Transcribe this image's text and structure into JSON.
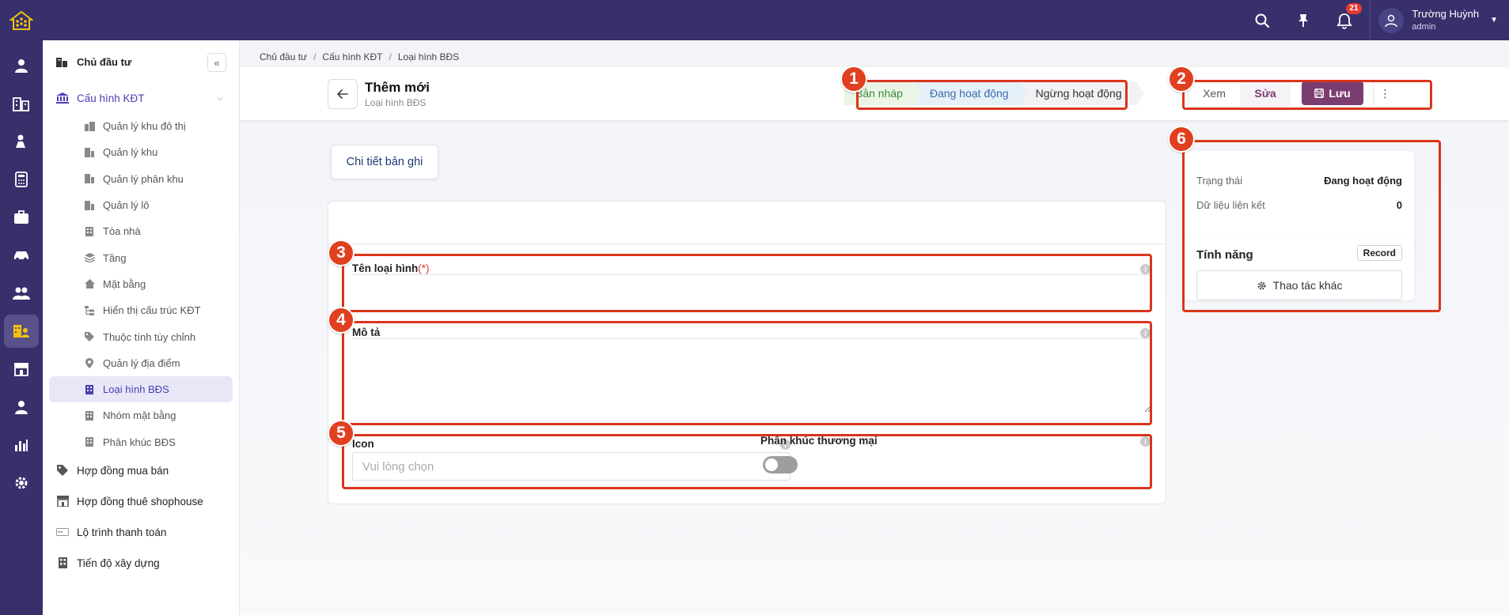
{
  "topbar": {
    "notification_count": "21",
    "user_name": "Trường Huỳnh",
    "user_role": "admin"
  },
  "sidebar": {
    "header": "Chủ đầu tư",
    "group": "Cấu hình KĐT",
    "sub_items": [
      "Quản lý khu đô thị",
      "Quản lý khu",
      "Quản lý phân khu",
      "Quản lý lô",
      "Tòa nhà",
      "Tầng",
      "Mặt bằng",
      "Hiển thị cấu trúc KĐT",
      "Thuộc tính tùy chỉnh",
      "Quản lý địa điểm",
      "Loại hình BĐS",
      "Nhóm mặt bằng",
      "Phân khúc BĐS"
    ],
    "main_items": [
      "Hợp đồng mua bán",
      "Hợp đồng thuê shophouse",
      "Lộ trình thanh toán",
      "Tiến độ xây dựng"
    ]
  },
  "breadcrumb": [
    "Chủ đầu tư",
    "Cấu hình KĐT",
    "Loại hình BĐS"
  ],
  "header": {
    "title": "Thêm mới",
    "subtitle": "Loại hình BĐS"
  },
  "status_steps": [
    "Bản nháp",
    "Đang hoạt động",
    "Ngừng hoạt động"
  ],
  "actions": {
    "view": "Xem",
    "edit": "Sửa",
    "save": "Lưu",
    "more": "⋮"
  },
  "tab": "Chi tiết bản ghi",
  "form": {
    "name_label": "Tên loại hình",
    "required_mark": "(*)",
    "desc_label": "Mô tả",
    "icon_label": "Icon",
    "icon_placeholder": "Vui lòng chọn",
    "segment_label": "Phân khúc thương mại"
  },
  "info": {
    "status_key": "Trạng thái",
    "status_val": "Đang hoạt động",
    "linked_key": "Dữ liệu liên kết",
    "linked_val": "0"
  },
  "features": {
    "title": "Tính năng",
    "tag": "Record",
    "more_button": "Thao tác khác"
  },
  "annotations": [
    "1",
    "2",
    "3",
    "4",
    "5",
    "6"
  ],
  "colors": {
    "topbar": "#37306b",
    "accent": "#4a3fb0",
    "save": "#7b3d6f",
    "annotation": "#d9351c"
  }
}
